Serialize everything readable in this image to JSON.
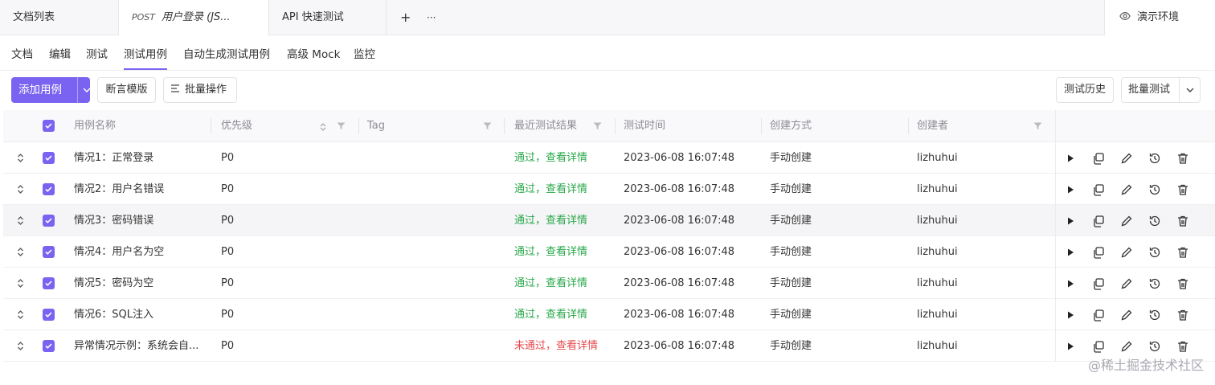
{
  "tabs": {
    "doc_list": "文档列表",
    "active_method": "POST",
    "active_name": "用户登录 (JS...",
    "api_quick_test": "API 快速测试",
    "add": "+",
    "more": "···",
    "environment": "演示环境"
  },
  "subnav": [
    "文档",
    "编辑",
    "测试",
    "测试用例",
    "自动生成测试用例",
    "高级 Mock",
    "监控"
  ],
  "toolbar": {
    "add_case": "添加用例",
    "assert_template": "断言模版",
    "batch_ops": "批量操作",
    "test_history": "测试历史",
    "batch_test": "批量测试"
  },
  "columns": {
    "name": "用例名称",
    "priority": "优先级",
    "tag": "Tag",
    "last_result": "最近测试结果",
    "test_time": "测试时间",
    "create_method": "创建方式",
    "creator": "创建者"
  },
  "rows": [
    {
      "name": "情况1：正常登录",
      "priority": "P0",
      "result": "通过，查看详情",
      "status": "pass",
      "time": "2023-06-08 16:07:48",
      "method": "手动创建",
      "creator": "lizhuhui"
    },
    {
      "name": "情况2：用户名错误",
      "priority": "P0",
      "result": "通过，查看详情",
      "status": "pass",
      "time": "2023-06-08 16:07:48",
      "method": "手动创建",
      "creator": "lizhuhui"
    },
    {
      "name": "情况3：密码错误",
      "priority": "P0",
      "result": "通过，查看详情",
      "status": "pass",
      "time": "2023-06-08 16:07:48",
      "method": "手动创建",
      "creator": "lizhuhui"
    },
    {
      "name": "情况4：用户名为空",
      "priority": "P0",
      "result": "通过，查看详情",
      "status": "pass",
      "time": "2023-06-08 16:07:48",
      "method": "手动创建",
      "creator": "lizhuhui"
    },
    {
      "name": "情况5：密码为空",
      "priority": "P0",
      "result": "通过，查看详情",
      "status": "pass",
      "time": "2023-06-08 16:07:48",
      "method": "手动创建",
      "creator": "lizhuhui"
    },
    {
      "name": "情况6：SQL注入",
      "priority": "P0",
      "result": "通过，查看详情",
      "status": "pass",
      "time": "2023-06-08 16:07:48",
      "method": "手动创建",
      "creator": "lizhuhui"
    },
    {
      "name": "异常情况示例：系统会自...",
      "priority": "P0",
      "result": "未通过，查看详情",
      "status": "fail",
      "time": "2023-06-08 16:07:48",
      "method": "手动创建",
      "creator": "lizhuhui"
    }
  ],
  "row_actions": [
    "play-icon",
    "copy-icon",
    "edit-icon",
    "history-icon",
    "delete-icon"
  ],
  "colors": {
    "accent": "#7a63f0",
    "pass": "#2aa84a",
    "fail": "#e5484d"
  },
  "watermark": "@稀土掘金技术社区"
}
